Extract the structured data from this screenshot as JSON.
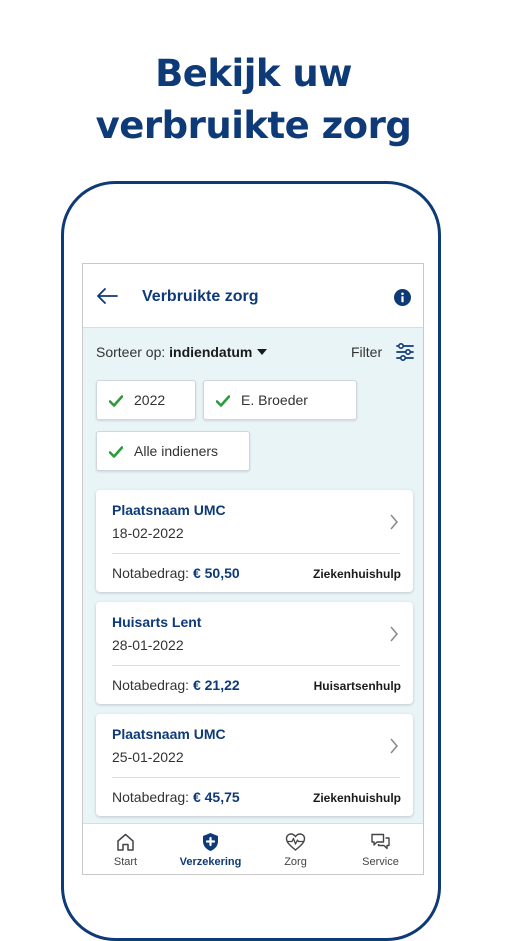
{
  "headline": {
    "line1": "Bekijk uw",
    "line2": "verbruikte zorg"
  },
  "appbar": {
    "title": "Verbruikte zorg",
    "back_icon": "arrow-left-icon",
    "info_icon": "info-icon"
  },
  "sort": {
    "label": "Sorteer op:",
    "value": "indiendatum"
  },
  "filter": {
    "label": "Filter",
    "icon": "sliders-icon"
  },
  "chips": [
    {
      "label": "2022"
    },
    {
      "label": "E. Broeder"
    },
    {
      "label": "Alle indieners"
    }
  ],
  "claims": [
    {
      "name": "Plaatsnaam UMC",
      "date": "18-02-2022",
      "amount_label": "Notabedrag:",
      "amount": "€ 50,50",
      "category": "Ziekenhuishulp"
    },
    {
      "name": "Huisarts Lent",
      "date": "28-01-2022",
      "amount_label": "Notabedrag:",
      "amount": "€ 21,22",
      "category": "Huisartsenhulp"
    },
    {
      "name": "Plaatsnaam UMC",
      "date": "25-01-2022",
      "amount_label": "Notabedrag:",
      "amount": "€ 45,75",
      "category": "Ziekenhuishulp"
    }
  ],
  "tabs": [
    {
      "label": "Start",
      "icon": "home-icon"
    },
    {
      "label": "Verzekering",
      "icon": "shield-plus-icon",
      "active": true
    },
    {
      "label": "Zorg",
      "icon": "heart-pulse-icon"
    },
    {
      "label": "Service",
      "icon": "chat-bubbles-icon"
    }
  ],
  "colors": {
    "brand": "#0f3a78",
    "check": "#2a9d3a",
    "screen_bg": "#e9f4f7"
  }
}
